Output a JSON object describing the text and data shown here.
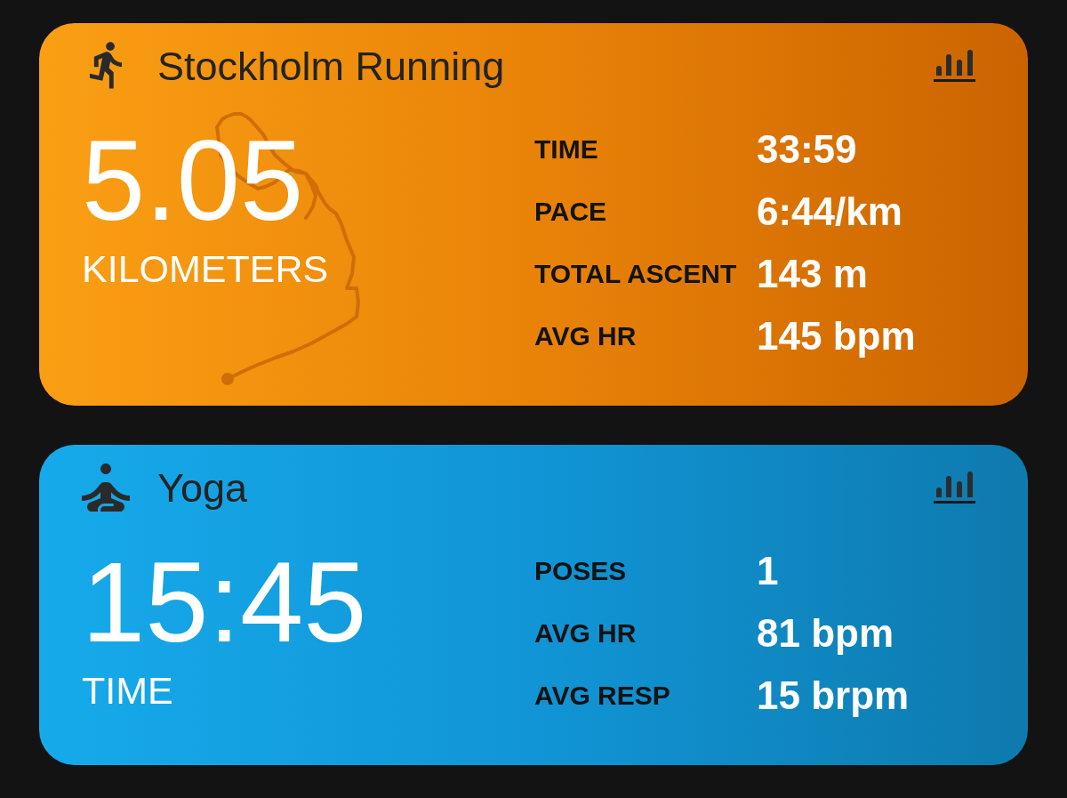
{
  "activities": [
    {
      "kind": "running",
      "title": "Stockholm Running",
      "headline_value": "5.05",
      "headline_label": "KILOMETERS",
      "stats": [
        {
          "label": "TIME",
          "value": "33:59"
        },
        {
          "label": "PACE",
          "value": "6:44/km"
        },
        {
          "label": "TOTAL ASCENT",
          "value": "143 m"
        },
        {
          "label": "AVG HR",
          "value": "145 bpm"
        }
      ]
    },
    {
      "kind": "yoga",
      "title": "Yoga",
      "headline_value": "15:45",
      "headline_label": "TIME",
      "stats": [
        {
          "label": "POSES",
          "value": "1"
        },
        {
          "label": "AVG HR",
          "value": "81 bpm"
        },
        {
          "label": "AVG RESP",
          "value": "15 brpm"
        }
      ]
    }
  ]
}
